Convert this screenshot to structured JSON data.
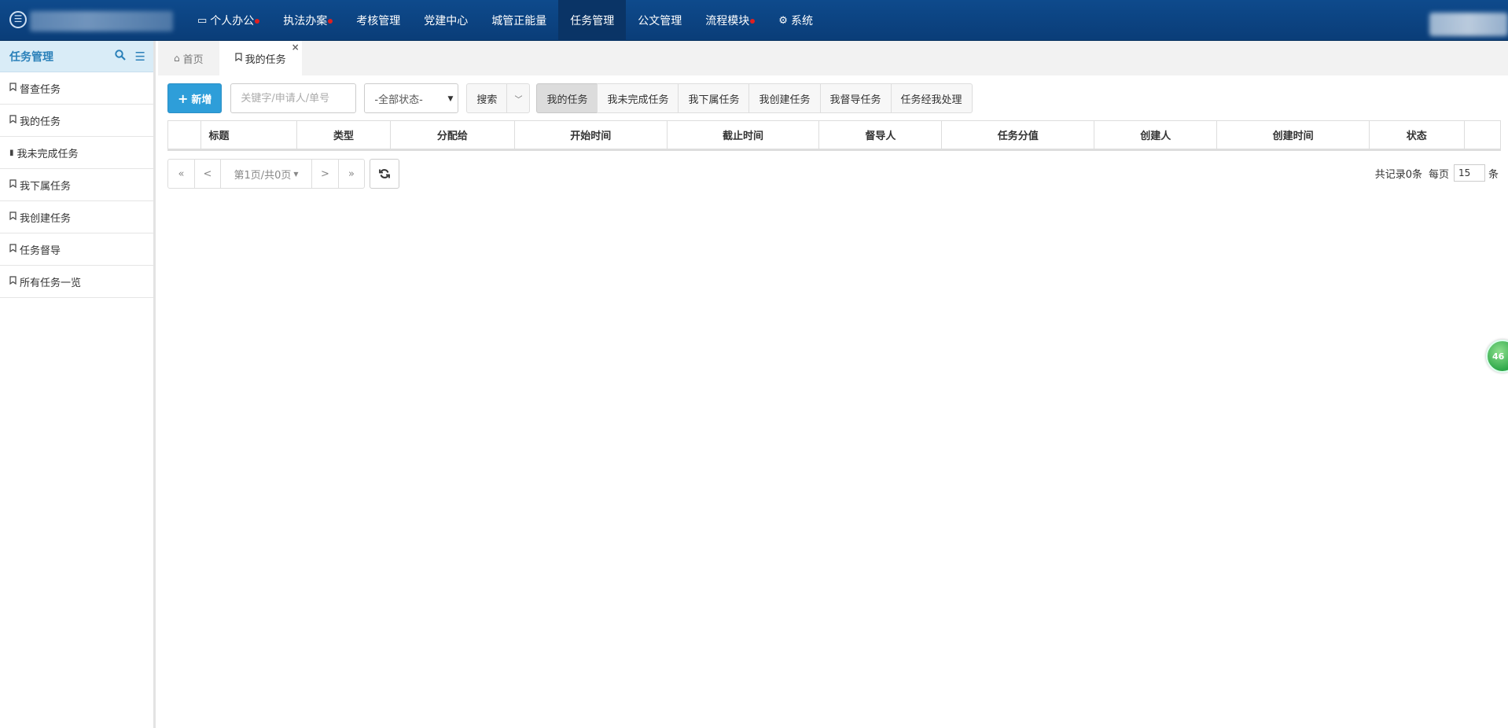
{
  "topnav": {
    "items": [
      {
        "label": "个人办公",
        "icon": "monitor-icon",
        "dot": true
      },
      {
        "label": "执法办案",
        "dot": true
      },
      {
        "label": "考核管理"
      },
      {
        "label": "党建中心"
      },
      {
        "label": "城管正能量"
      },
      {
        "label": "任务管理",
        "active": true
      },
      {
        "label": "公文管理"
      },
      {
        "label": "流程模块",
        "dot": true
      },
      {
        "label": "系统",
        "icon": "gear-icon"
      }
    ],
    "dot_color": "#e02020"
  },
  "sidebar": {
    "title": "任务管理",
    "items": [
      {
        "label": "督查任务",
        "icon": "bookmark-icon"
      },
      {
        "label": "我的任务",
        "icon": "bookmark-icon"
      },
      {
        "label": "我未完成任务",
        "icon": "book-icon"
      },
      {
        "label": "我下属任务",
        "icon": "bookmark-icon"
      },
      {
        "label": "我创建任务",
        "icon": "bookmark-icon"
      },
      {
        "label": "任务督导",
        "icon": "bookmark-icon"
      },
      {
        "label": "所有任务一览",
        "icon": "bookmark-icon"
      }
    ]
  },
  "tabs": [
    {
      "label": "首页",
      "icon": "home-icon"
    },
    {
      "label": "我的任务",
      "icon": "bookmark-icon",
      "active": true,
      "close": "×"
    }
  ],
  "toolbar": {
    "add_label": "新增",
    "search_placeholder": "关键字/申请人/单号",
    "status_value": "-全部状态-",
    "search_label": "搜索",
    "filters": [
      "我的任务",
      "我未完成任务",
      "我下属任务",
      "我创建任务",
      "我督导任务",
      "任务经我处理"
    ],
    "active_filter": 0
  },
  "table": {
    "columns": [
      "",
      "标题",
      "类型",
      "分配给",
      "开始时间",
      "截止时间",
      "督导人",
      "任务分值",
      "创建人",
      "创建时间",
      "状态",
      ""
    ],
    "rows": []
  },
  "pager": {
    "first": "«",
    "prev": "<",
    "page_info": "第1页/共0页",
    "next": ">",
    "last": "»",
    "total_text": "共记录0条",
    "per_page_label": "每页",
    "page_size": "15",
    "unit": "条"
  },
  "float_badge": "46"
}
